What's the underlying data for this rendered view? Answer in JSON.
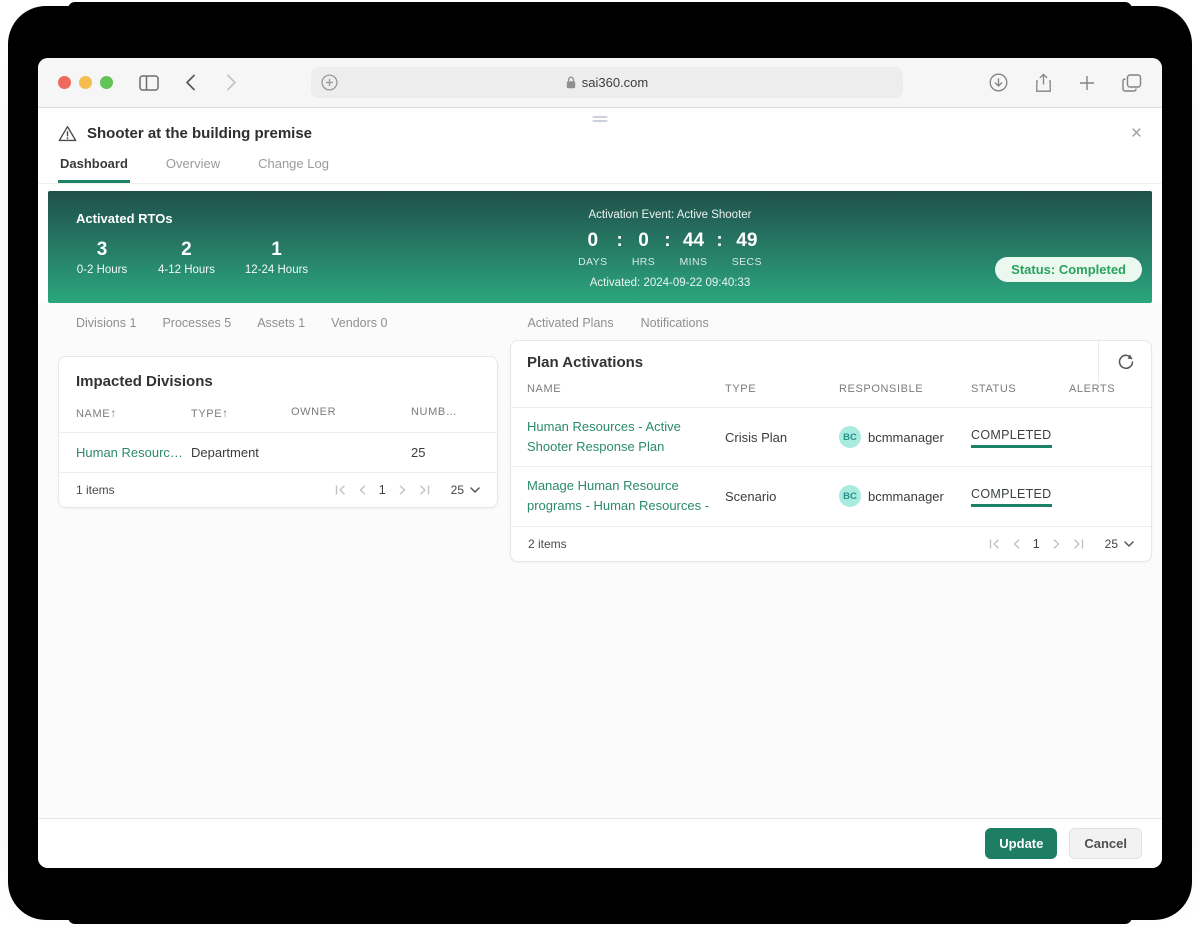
{
  "browser": {
    "url": "sai360.com"
  },
  "modal": {
    "title": "Shooter at the building premise",
    "close_label": "×",
    "tabs": [
      {
        "label": "Dashboard"
      },
      {
        "label": "Overview"
      },
      {
        "label": "Change Log"
      }
    ]
  },
  "banner": {
    "title": "Activated RTOs",
    "rtos": [
      {
        "count": "3",
        "label": "0-2 Hours"
      },
      {
        "count": "2",
        "label": "4-12 Hours"
      },
      {
        "count": "1",
        "label": "12-24 Hours"
      }
    ],
    "event_label": "Activation Event: Active Shooter",
    "timer_separator": ":",
    "timer": [
      {
        "value": "0",
        "unit": "DAYS"
      },
      {
        "value": "0",
        "unit": "HRS"
      },
      {
        "value": "44",
        "unit": "MINS"
      },
      {
        "value": "49",
        "unit": "SECS"
      }
    ],
    "activated": "Activated: 2024-09-22 09:40:33",
    "status": "Status: Completed"
  },
  "subtabs": {
    "left": [
      "Divisions 1",
      "Processes 5",
      "Assets 1",
      "Vendors 0"
    ],
    "right": [
      "Activated Plans",
      "Notifications"
    ]
  },
  "divisions_card": {
    "title": "Impacted Divisions",
    "columns": {
      "name": "NAME",
      "type": "TYPE",
      "owner": "OWNER",
      "number": "NUMB…"
    },
    "sort_arrow": "↑",
    "rows": [
      {
        "name": "Human Resourc…",
        "type": "Department",
        "owner": "",
        "number": "25"
      }
    ],
    "footer": {
      "items": "1 items",
      "page": "1",
      "page_size": "25"
    }
  },
  "plans_card": {
    "title": "Plan Activations",
    "columns": {
      "name": "NAME",
      "type": "TYPE",
      "responsible": "RESPONSIBLE",
      "status": "STATUS",
      "alerts": "ALERTS"
    },
    "rows": [
      {
        "name": "Human Resources - Active Shooter Response Plan",
        "type": "Crisis Plan",
        "responsible_initials": "BC",
        "responsible": "bcmmanager",
        "status": "COMPLETED",
        "alerts": ""
      },
      {
        "name": "Manage Human Resource programs - Human Resources -",
        "type": "Scenario",
        "responsible_initials": "BC",
        "responsible": "bcmmanager",
        "status": "COMPLETED",
        "alerts": ""
      }
    ],
    "footer": {
      "items": "2 items",
      "page": "1",
      "page_size": "25"
    }
  },
  "footer_bar": {
    "update_label": "Update",
    "cancel_label": "Cancel"
  },
  "colors": {
    "accent_green": "#1b8266",
    "banner_gradient_top": "#20504b",
    "banner_gradient_bottom": "#2ba77c",
    "status_pill_bg": "#ebf8ef",
    "status_pill_text": "#28a35e",
    "link_green": "#2b8a6d",
    "update_button_bg": "#1e7e63",
    "avatar_bg": "#a9ebdf",
    "avatar_text": "#269188"
  }
}
